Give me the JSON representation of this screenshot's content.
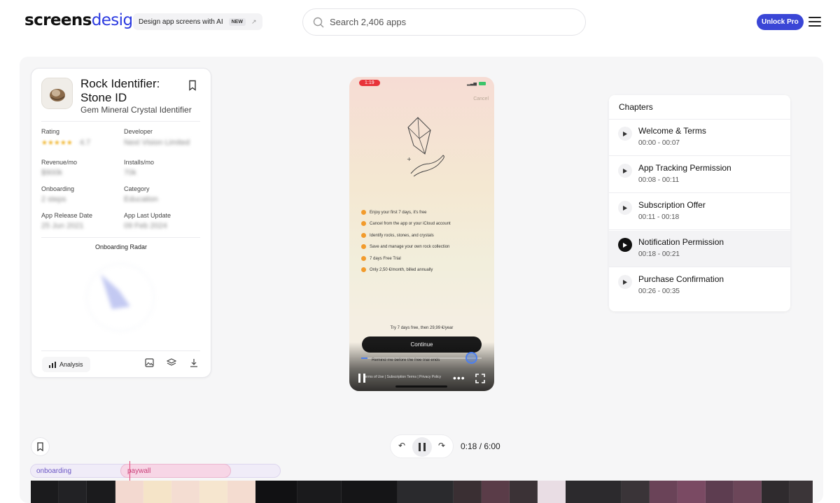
{
  "header": {
    "logo_part1": "screens",
    "logo_part2": "design",
    "promo_text": "Design app screens with AI",
    "promo_badge": "NEW",
    "search_placeholder": "Search 2,406 apps",
    "unlock_label": "Unlock Pro"
  },
  "app": {
    "title": "Rock Identifier: Stone ID",
    "subtitle": "Gem Mineral Crystal Identifier",
    "metrics": [
      {
        "label": "Rating",
        "value": "4.7"
      },
      {
        "label": "Developer",
        "value": "Next Vision Limited"
      },
      {
        "label": "Revenue/mo",
        "value": "$900k"
      },
      {
        "label": "Installs/mo",
        "value": "70k"
      },
      {
        "label": "Onboarding",
        "value": "2 steps"
      },
      {
        "label": "Category",
        "value": "Education"
      },
      {
        "label": "App Release Date",
        "value": "25 Jun 2021"
      },
      {
        "label": "App Last Update",
        "value": "09 Feb 2024"
      }
    ],
    "radar_title": "Onboarding Radar",
    "analysis_label": "Analysis"
  },
  "phone": {
    "status_time": "1:19",
    "cancel": "Cancel",
    "features": [
      "Enjoy your first 7 days, it's free",
      "Cancel from the app or your iCloud account",
      "Identify rocks, stones, and crystals",
      "Save and manage your own rock collection",
      "7 days Free Trial",
      "Only 2,50 €/month, billed annually"
    ],
    "trial_text": "Try 7 days free, then 29,99 €/year",
    "continue_label": "Continue",
    "remind_text": "Remind me before the free trial ends",
    "legal_text": "Terms of Use  |  Subscription Terms  |  Privacy Policy",
    "progress_fraction": 0.05
  },
  "chapters": {
    "title": "Chapters",
    "items": [
      {
        "name": "Welcome & Terms",
        "range": "00:00 - 00:07"
      },
      {
        "name": "App Tracking Permission",
        "range": "00:08 - 00:11"
      },
      {
        "name": "Subscription Offer",
        "range": "00:11 - 00:18"
      },
      {
        "name": "Notification Permission",
        "range": "00:18 - 00:21",
        "active": true
      },
      {
        "name": "Purchase Confirmation",
        "range": "00:26 - 00:35"
      }
    ]
  },
  "playback": {
    "timecode": "0:18 / 6:00",
    "segments": [
      "onboarding",
      "paywall"
    ]
  },
  "colors": {
    "brand": "#2c3be0",
    "unlock": "#3a46d6",
    "paywall": "#c93e78",
    "accent_dot": "#f29b2c"
  }
}
